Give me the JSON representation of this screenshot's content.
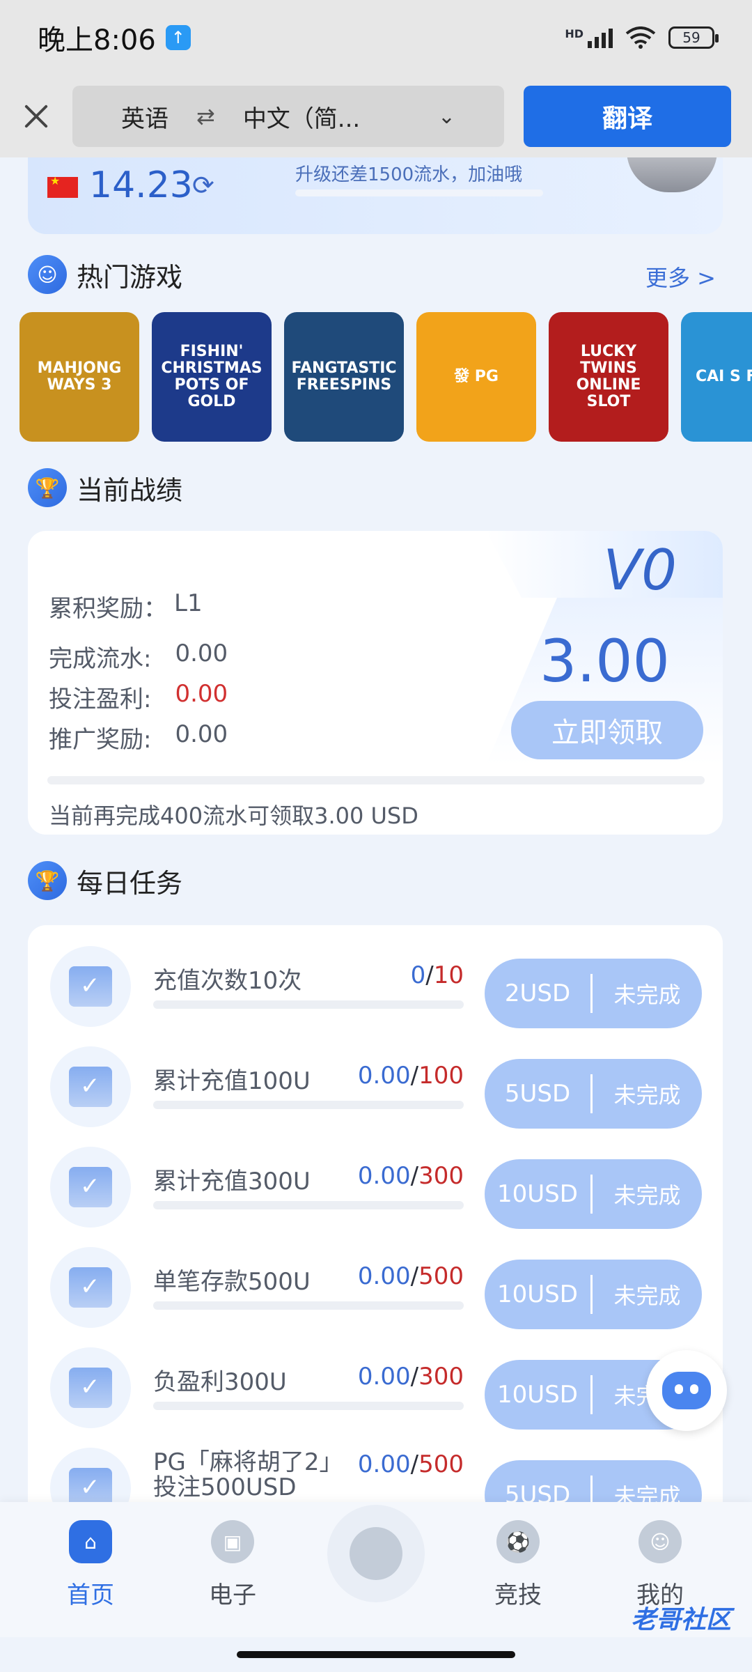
{
  "status_bar": {
    "time": "晚上8:06",
    "hd": "HD",
    "battery": "59"
  },
  "translate_bar": {
    "source_lang": "英语",
    "swap_icon": "⇄",
    "target_lang": "中文（简...",
    "translate_label": "翻译"
  },
  "vip": {
    "balance": "14.23",
    "upgrade_text": "升级还差1500流水，加油哦"
  },
  "hot_games": {
    "title": "热门游戏",
    "more": "更多 >",
    "items": [
      {
        "label": "MAHJONG WAYS 3",
        "color": "#c8911f"
      },
      {
        "label": "FISHIN' CHRISTMAS POTS OF GOLD",
        "color": "#1d3a8a"
      },
      {
        "label": "FANGTASTIC FREESPINS",
        "color": "#1f4a7a"
      },
      {
        "label": "發 PG",
        "color": "#f2a31a"
      },
      {
        "label": "LUCKY TWINS ONLINE SLOT",
        "color": "#b31d1d"
      },
      {
        "label": "CAI S FISH",
        "color": "#2a93d5"
      }
    ]
  },
  "record": {
    "title": "当前战绩",
    "level": "V0",
    "reward_line_label": "累积奖励：",
    "reward_line_value": "L1",
    "lines": [
      {
        "label": "完成流水:",
        "value": "0.00"
      },
      {
        "label": "投注盈利:",
        "value": "0.00"
      },
      {
        "label": "推广奖励:",
        "value": "0.00"
      }
    ],
    "amount": "3.00",
    "claim_label": "立即领取",
    "note": "当前再完成400流水可领取3.00 USD"
  },
  "daily_tasks": {
    "title": "每日任务",
    "items": [
      {
        "title": "充值次数10次",
        "current": "0",
        "total": "10",
        "reward": "2USD",
        "state": "未完成"
      },
      {
        "title": "累计充值100U",
        "current": "0.00",
        "total": "100",
        "reward": "5USD",
        "state": "未完成"
      },
      {
        "title": "累计充值300U",
        "current": "0.00",
        "total": "300",
        "reward": "10USD",
        "state": "未完成"
      },
      {
        "title": "单笔存款500U",
        "current": "0.00",
        "total": "500",
        "reward": "10USD",
        "state": "未完成"
      },
      {
        "title": "负盈利300U",
        "current": "0.00",
        "total": "300",
        "reward": "10USD",
        "state": "未完成"
      },
      {
        "title": "PG「麻将胡了2」投注500USD",
        "current": "0.00",
        "total": "500",
        "reward": "5USD",
        "state": "未完成"
      }
    ]
  },
  "bottom_nav": {
    "items": [
      {
        "label": "首页",
        "icon": "home-icon"
      },
      {
        "label": "电子",
        "icon": "slot-machine-icon"
      },
      {
        "label": "竞技",
        "icon": "football-icon"
      },
      {
        "label": "我的",
        "icon": "profile-icon"
      }
    ],
    "center_icon": "coins-icon"
  },
  "watermark": "老哥社区",
  "colors": {
    "primary": "#2f6fe3",
    "button_light": "#a9c6f7",
    "danger": "#c52b2b"
  }
}
